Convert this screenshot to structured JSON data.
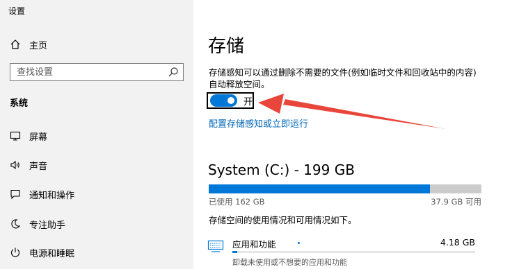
{
  "window": {
    "title": "设置"
  },
  "sidebar": {
    "home_label": "主页",
    "search_placeholder": "查找设置",
    "section_label": "系统",
    "items": [
      {
        "label": "屏幕",
        "icon": "display-icon"
      },
      {
        "label": "声音",
        "icon": "speaker-icon"
      },
      {
        "label": "通知和操作",
        "icon": "notification-icon"
      },
      {
        "label": "专注助手",
        "icon": "moon-icon"
      },
      {
        "label": "电源和睡眠",
        "icon": "power-icon"
      }
    ]
  },
  "main": {
    "title": "存储",
    "description": "存储感知可以通过删除不需要的文件(例如临时文件和回收站中的内容)自动释放空间。",
    "toggle": {
      "state": "on",
      "label": "开"
    },
    "config_link": "配置存储感知或立即运行",
    "drive": {
      "title": "System (C:) - 199 GB",
      "used_label": "已使用 162 GB",
      "free_label": "37.9 GB 可用",
      "used_fraction": 0.81
    },
    "usage_note": "存储空间的使用情况和可用情况如下。",
    "categories": [
      {
        "name": "应用和功能",
        "size": "4.18 GB",
        "subtitle": "卸载未使用或不想要的应用和功能",
        "fraction": 0.02
      }
    ]
  },
  "colors": {
    "accent": "#0078d7",
    "link": "#0067b8",
    "annotation_arrow": "#e8463a"
  }
}
